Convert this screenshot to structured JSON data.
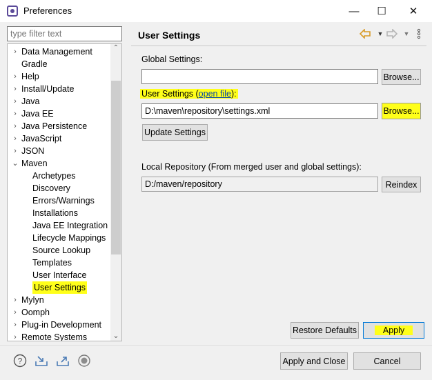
{
  "window": {
    "title": "Preferences",
    "minimize_glyph": "—",
    "maximize_glyph": "☐",
    "close_glyph": "✕"
  },
  "filter": {
    "placeholder": "type filter text"
  },
  "tree": {
    "items": [
      {
        "label": "Data Management",
        "expander": "›",
        "indent": 0
      },
      {
        "label": "Gradle",
        "expander": "",
        "indent": 0
      },
      {
        "label": "Help",
        "expander": "›",
        "indent": 0
      },
      {
        "label": "Install/Update",
        "expander": "›",
        "indent": 0
      },
      {
        "label": "Java",
        "expander": "›",
        "indent": 0
      },
      {
        "label": "Java EE",
        "expander": "›",
        "indent": 0
      },
      {
        "label": "Java Persistence",
        "expander": "›",
        "indent": 0
      },
      {
        "label": "JavaScript",
        "expander": "›",
        "indent": 0
      },
      {
        "label": "JSON",
        "expander": "›",
        "indent": 0
      },
      {
        "label": "Maven",
        "expander": "⌄",
        "indent": 0
      },
      {
        "label": "Archetypes",
        "expander": "",
        "indent": 1
      },
      {
        "label": "Discovery",
        "expander": "",
        "indent": 1
      },
      {
        "label": "Errors/Warnings",
        "expander": "",
        "indent": 1
      },
      {
        "label": "Installations",
        "expander": "",
        "indent": 1
      },
      {
        "label": "Java EE Integration",
        "expander": "",
        "indent": 1
      },
      {
        "label": "Lifecycle Mappings",
        "expander": "",
        "indent": 1
      },
      {
        "label": "Source Lookup",
        "expander": "",
        "indent": 1
      },
      {
        "label": "Templates",
        "expander": "",
        "indent": 1
      },
      {
        "label": "User Interface",
        "expander": "",
        "indent": 1
      },
      {
        "label": "User Settings",
        "expander": "",
        "indent": 1
      },
      {
        "label": "Mylyn",
        "expander": "›",
        "indent": 0
      },
      {
        "label": "Oomph",
        "expander": "›",
        "indent": 0
      },
      {
        "label": "Plug-in Development",
        "expander": "›",
        "indent": 0
      },
      {
        "label": "Remote Systems",
        "expander": "›",
        "indent": 0
      }
    ],
    "selected": "User Settings",
    "scroll_up": "⌃",
    "scroll_down": "⌄"
  },
  "page": {
    "title": "User Settings",
    "global_settings_label": "Global Settings:",
    "global_settings_value": "",
    "global_browse": "Browse...",
    "user_settings_label": "User Settings (",
    "open_file_link": "open file",
    "user_settings_label_end": "):",
    "user_settings_value": "D:\\maven\\repository\\settings.xml",
    "user_browse": "Browse...",
    "update_settings": "Update Settings",
    "local_repo_label": "Local Repository (From merged user and global settings):",
    "local_repo_value": "D:/maven/repository",
    "reindex": "Reindex",
    "restore_defaults": "Restore Defaults",
    "apply": "Apply"
  },
  "footer": {
    "apply_and_close": "Apply and Close",
    "cancel": "Cancel"
  },
  "colors": {
    "highlight": "#ffff1a",
    "accent": "#0078d7",
    "link": "#0645ad"
  }
}
